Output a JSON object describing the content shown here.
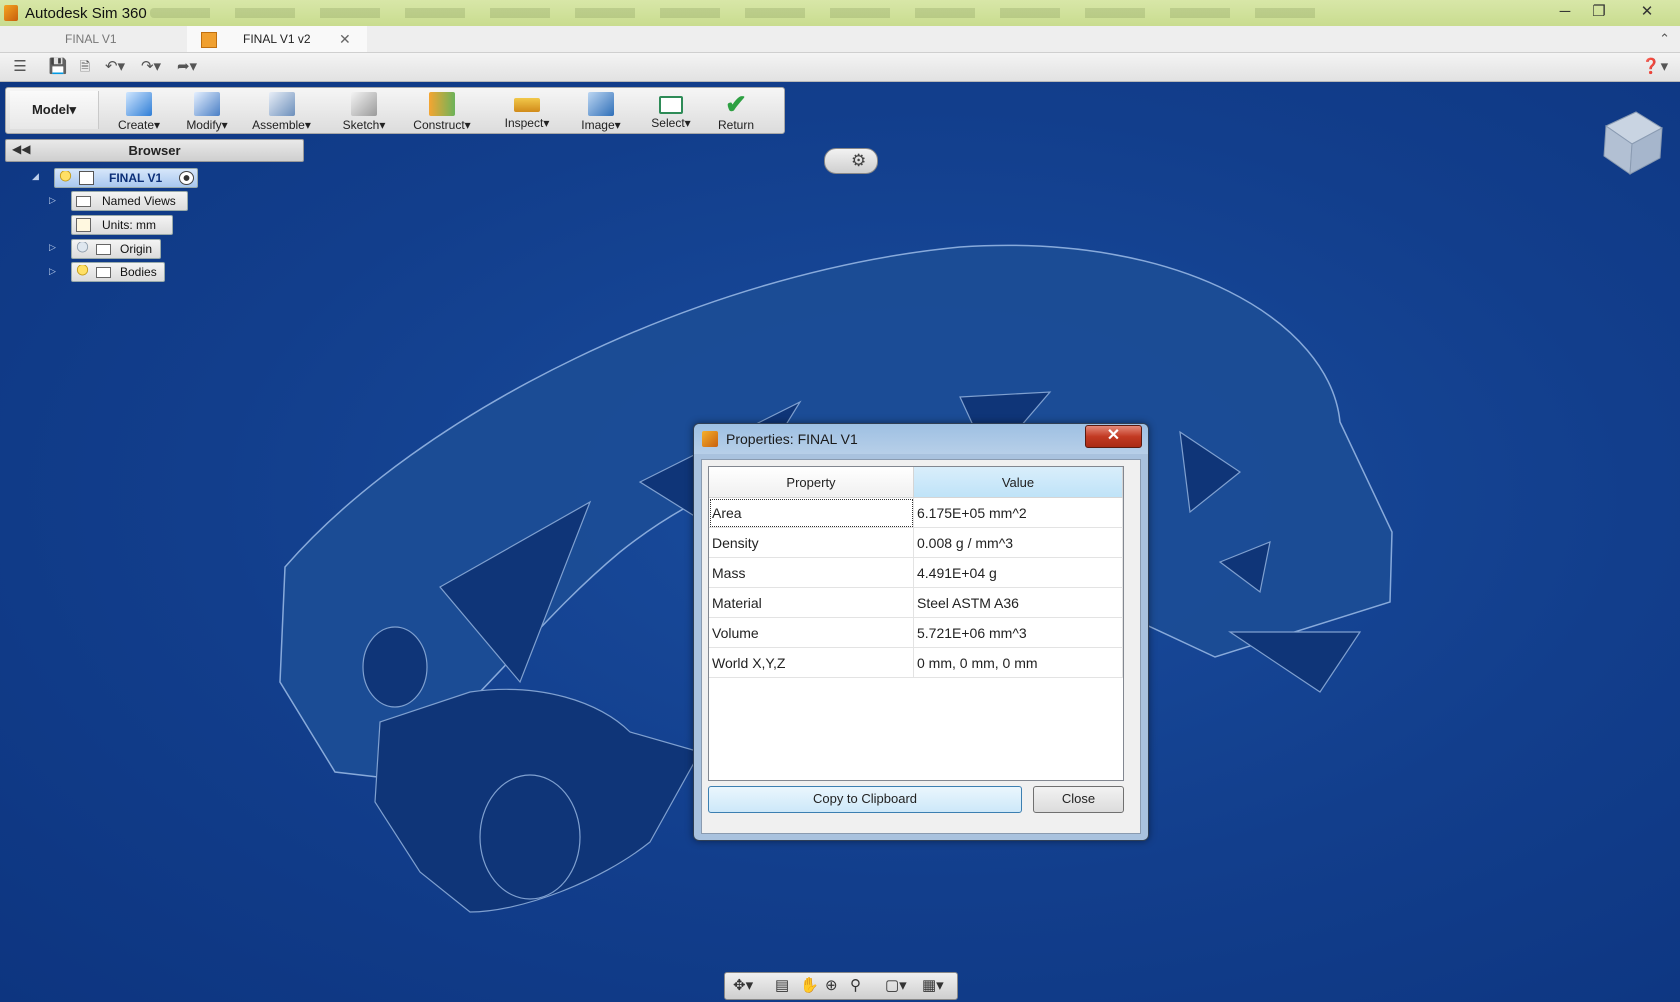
{
  "app": {
    "title": "Autodesk Sim 360"
  },
  "tabs": [
    {
      "label": "FINAL V1",
      "active": false
    },
    {
      "label": "FINAL V1 v2",
      "active": true
    }
  ],
  "ribbon": {
    "workspace": "Model",
    "tools": [
      "Create",
      "Modify",
      "Assemble",
      "Sketch",
      "Construct",
      "Inspect",
      "Image",
      "Select",
      "Return"
    ]
  },
  "browser": {
    "title": "Browser",
    "root": "FINAL V1",
    "items": [
      "Named Views",
      "Units: mm",
      "Origin",
      "Bodies"
    ]
  },
  "dialog": {
    "title": "Properties: FINAL V1",
    "headers": {
      "property": "Property",
      "value": "Value"
    },
    "rows": [
      {
        "property": "Area",
        "value": "6.175E+05 mm^2"
      },
      {
        "property": "Density",
        "value": "0.008 g / mm^3"
      },
      {
        "property": "Mass",
        "value": "4.491E+04 g"
      },
      {
        "property": "Material",
        "value": "Steel ASTM A36"
      },
      {
        "property": "Volume",
        "value": "5.721E+06 mm^3"
      },
      {
        "property": "World X,Y,Z",
        "value": "0 mm, 0 mm, 0 mm"
      }
    ],
    "copy_label": "Copy to Clipboard",
    "close_label": "Close",
    "close_x": "✕"
  },
  "colors": {
    "viewport_bg": "#123e8c",
    "titlebar_bg": "#d2e39c",
    "dialog_frame": "#a9c2de",
    "value_header": "#c9e8fa"
  },
  "icons": [
    "hamburger-icon",
    "save-icon",
    "undo-icon",
    "redo-icon",
    "share-icon",
    "help-icon",
    "gear-icon",
    "orbit-icon",
    "pan-icon",
    "zoom-icon",
    "display-icon",
    "grid-icon",
    "viewcube-icon"
  ]
}
